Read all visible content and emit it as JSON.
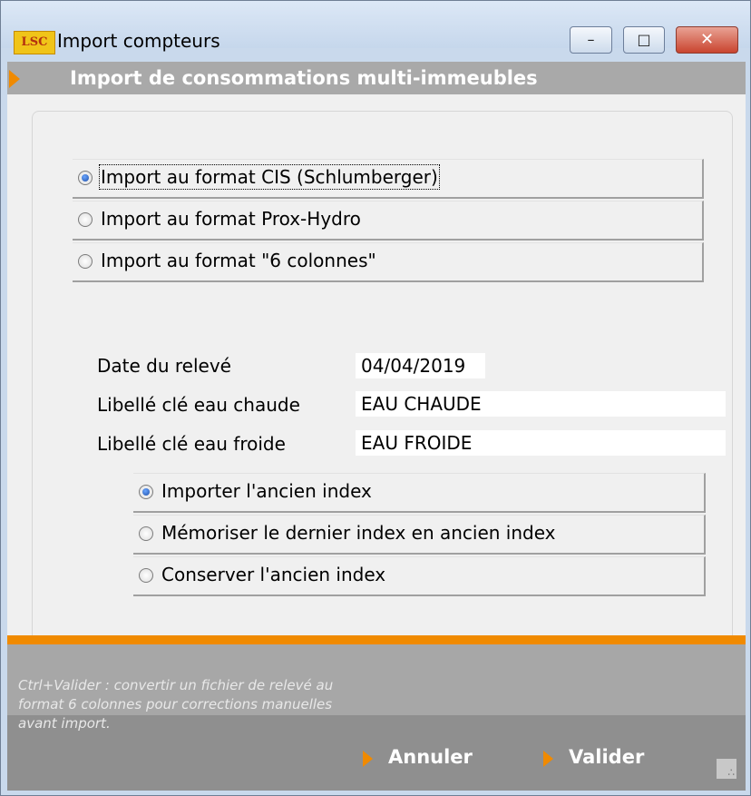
{
  "window": {
    "title": "Import compteurs",
    "logo_text": "LSC",
    "controls": {
      "minimize": "–",
      "maximize": "□",
      "close": "✕"
    }
  },
  "header": {
    "title": "Import de consommations multi-immeubles"
  },
  "format_options": [
    {
      "label": "Import au format CIS (Schlumberger)",
      "checked": true
    },
    {
      "label": "Import au format Prox-Hydro",
      "checked": false
    },
    {
      "label": "Import au format \"6 colonnes\"",
      "checked": false
    }
  ],
  "fields": {
    "date_label": "Date du relevé",
    "date_value": "04/04/2019",
    "hot_label": "Libellé clé eau chaude",
    "hot_value": "EAU CHAUDE",
    "cold_label": "Libellé clé eau froide",
    "cold_value": "EAU FROIDE"
  },
  "index_options": [
    {
      "label": "Importer l'ancien index",
      "checked": true
    },
    {
      "label": "Mémoriser le dernier index en ancien index",
      "checked": false
    },
    {
      "label": "Conserver l'ancien index",
      "checked": false
    }
  ],
  "footer": {
    "hint": "Ctrl+Valider : convertir un fichier de relevé au format 6 colonnes pour corrections manuelles avant import.",
    "cancel_label": "Annuler",
    "validate_label": "Valider"
  },
  "colors": {
    "accent": "#f08a00",
    "header_bg": "#a9a9a9",
    "footer_bg": "#8f8f8f"
  },
  "icons": {
    "header_arrow": "orange-arrow-icon",
    "button_arrow": "orange-arrow-icon",
    "radio": "radio-icon",
    "grip": "resize-grip-icon"
  }
}
